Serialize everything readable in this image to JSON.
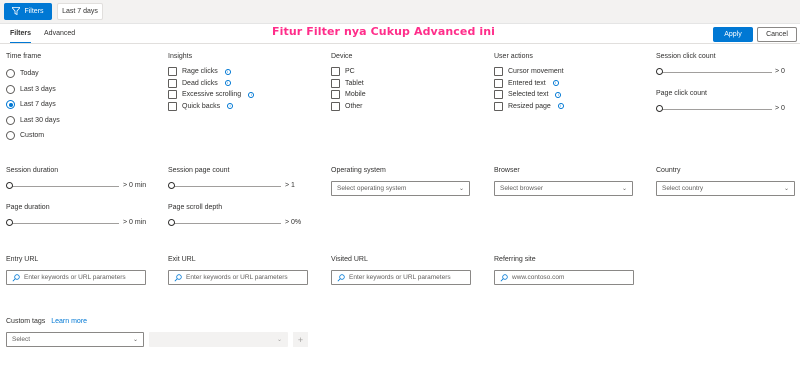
{
  "topbar": {
    "filters_label": "Filters",
    "time_chip": "Last 7 days"
  },
  "tabs": [
    {
      "label": "Filters"
    },
    {
      "label": "Advanced"
    }
  ],
  "overlay_text": "Fitur Filter nya Cukup Advanced ini",
  "actions": {
    "apply": "Apply",
    "cancel": "Cancel"
  },
  "time_frame": {
    "title": "Time frame",
    "options": [
      "Today",
      "Last 3 days",
      "Last 7 days",
      "Last 30 days",
      "Custom"
    ],
    "selected": "Last 7 days"
  },
  "insights": {
    "title": "Insights",
    "items": [
      "Rage clicks",
      "Dead clicks",
      "Excessive scrolling",
      "Quick backs"
    ]
  },
  "device": {
    "title": "Device",
    "items": [
      "PC",
      "Tablet",
      "Mobile",
      "Other"
    ]
  },
  "user_actions": {
    "title": "User actions",
    "items": [
      "Cursor movement",
      "Entered text",
      "Selected text",
      "Resized page"
    ]
  },
  "sliders": {
    "session_click_count": {
      "label": "Session click count",
      "value": "> 0"
    },
    "page_click_count": {
      "label": "Page click count",
      "value": "> 0"
    },
    "session_duration": {
      "label": "Session duration",
      "value": "> 0 min"
    },
    "session_page_count": {
      "label": "Session page count",
      "value": "> 1"
    },
    "page_duration": {
      "label": "Page duration",
      "value": "> 0 min"
    },
    "page_scroll_depth": {
      "label": "Page scroll depth",
      "value": "> 0%"
    }
  },
  "dropdowns": {
    "os": {
      "label": "Operating system",
      "placeholder": "Select operating system"
    },
    "browser": {
      "label": "Browser",
      "placeholder": "Select browser"
    },
    "country": {
      "label": "Country",
      "placeholder": "Select country"
    }
  },
  "urls": {
    "entry": {
      "label": "Entry URL",
      "placeholder": "Enter keywords or URL parameters"
    },
    "exit": {
      "label": "Exit URL",
      "placeholder": "Enter keywords or URL parameters"
    },
    "visited": {
      "label": "Visited URL",
      "placeholder": "Enter keywords or URL parameters"
    },
    "referring": {
      "label": "Referring site",
      "placeholder": "www.contoso.com"
    }
  },
  "custom_tags": {
    "label": "Custom tags",
    "learn_more": "Learn more",
    "select_placeholder": "Select",
    "plus": "+"
  },
  "icons": {
    "filter": "filter-icon",
    "info": "info-icon",
    "search": "search-icon",
    "chevron": "chevron-down-icon",
    "plus": "plus-icon"
  },
  "colors": {
    "accent": "#0078d4",
    "overlay": "#ff2d8a"
  }
}
